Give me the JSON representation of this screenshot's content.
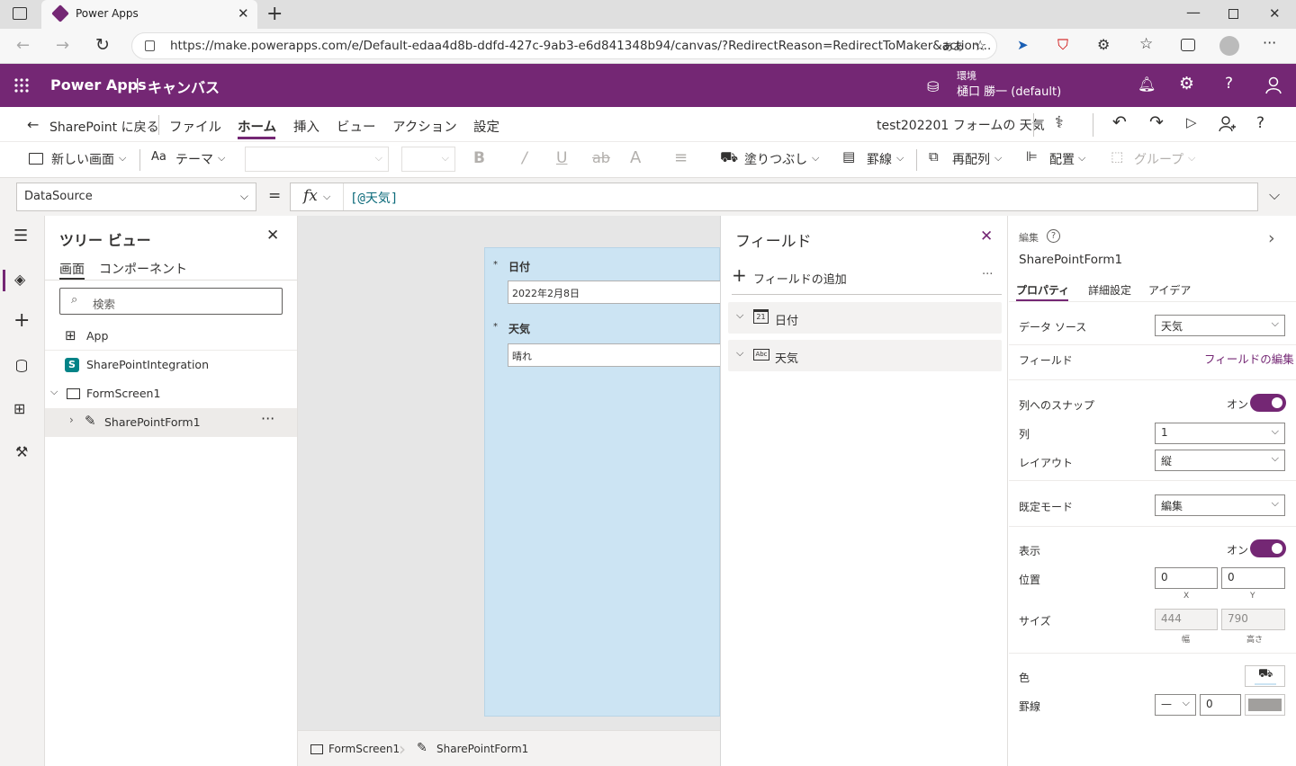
{
  "browser": {
    "tab_title": "Power Apps",
    "url": "https://make.powerapps.com/e/Default-edaa4d8b-ddfd-427c-9ab3-e6d841348b94/canvas/?RedirectReason=RedirectToMaker&action...",
    "read_aloud": "ああ"
  },
  "header": {
    "app_name": "Power Apps",
    "separator": "|",
    "section": "キャンバス",
    "env_label": "環境",
    "env_name": "樋口 勝一 (default)"
  },
  "cmdbar": {
    "back": "SharePoint に戻る",
    "menus": [
      "ファイル",
      "ホーム",
      "挿入",
      "ビュー",
      "アクション",
      "設定"
    ],
    "app_title": "test202201 フォームの 天気"
  },
  "ribbon": {
    "new_screen": "新しい画面",
    "theme": "テーマ",
    "fill": "塗りつぶし",
    "border": "罫線",
    "reorder": "再配列",
    "align": "配置",
    "group": "グループ"
  },
  "formula": {
    "property": "DataSource",
    "equals": "=",
    "fx": "fx",
    "value": "[@天気]"
  },
  "tree": {
    "title": "ツリー ビュー",
    "tab_screens": "画面",
    "tab_components": "コンポーネント",
    "search_placeholder": "検索",
    "items": [
      "App",
      "SharePointIntegration",
      "FormScreen1",
      "SharePointForm1"
    ]
  },
  "form": {
    "field1_label": "日付",
    "field1_value": "2022年2月8日",
    "field2_label": "天気",
    "field2_value": "晴れ",
    "required_mark": "*"
  },
  "breadcrumb": {
    "screen": "FormScreen1",
    "form": "SharePointForm1"
  },
  "fields_panel": {
    "title": "フィールド",
    "add": "フィールドの追加",
    "more": "···",
    "fields": [
      {
        "name": "日付",
        "icon": "calendar-icon",
        "icon_text": "21"
      },
      {
        "name": "天気",
        "icon": "text-field-icon",
        "icon_text": "Abc"
      }
    ]
  },
  "props": {
    "type_label": "編集",
    "control_name": "SharePointForm1",
    "tabs": [
      "プロパティ",
      "詳細設定",
      "アイデア"
    ],
    "data_source_label": "データ ソース",
    "data_source_value": "天気",
    "fields_label": "フィールド",
    "fields_edit": "フィールドの編集",
    "snap_label": "列へのスナップ",
    "snap_state": "オン",
    "columns_label": "列",
    "columns_value": "1",
    "layout_label": "レイアウト",
    "layout_value": "縦",
    "mode_label": "既定モード",
    "mode_value": "編集",
    "visible_label": "表示",
    "visible_state": "オン",
    "position_label": "位置",
    "pos_x": "0",
    "pos_y": "0",
    "pos_x_caption": "X",
    "pos_y_caption": "Y",
    "size_label": "サイズ",
    "size_w": "444",
    "size_h": "790",
    "size_w_caption": "幅",
    "size_h_caption": "高さ",
    "color_label": "色",
    "border_label": "罫線",
    "border_width": "0"
  },
  "colors": {
    "brand": "#742774",
    "form_bg": "#cce4f3",
    "canvas_bg": "#e6e6e6"
  }
}
